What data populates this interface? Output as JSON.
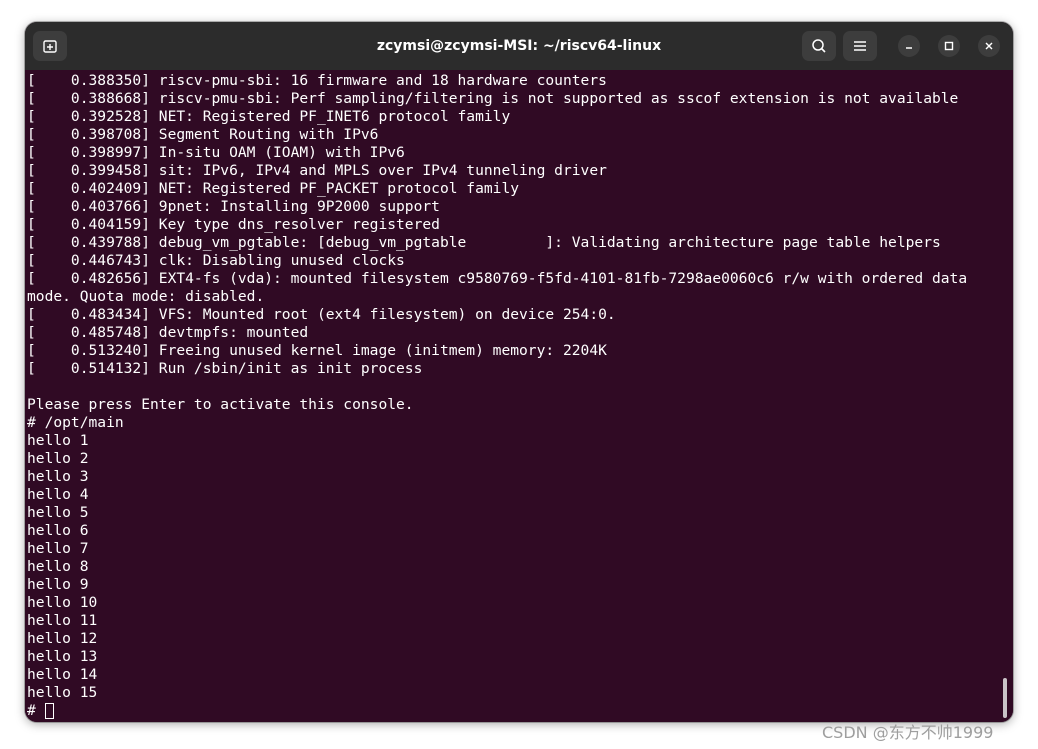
{
  "window": {
    "title": "zcymsi@zcymsi-MSI: ~/riscv64-linux"
  },
  "titlebar": {
    "new_tab_icon": "new-tab-icon",
    "search_icon": "search-icon",
    "menu_icon": "hamburger-menu-icon",
    "minimize_icon": "minimize-icon",
    "maximize_icon": "maximize-icon",
    "close_icon": "close-icon"
  },
  "terminal": {
    "background": "#300a24",
    "foreground": "#ffffff",
    "lines": [
      "[    0.388350] riscv-pmu-sbi: 16 firmware and 18 hardware counters",
      "[    0.388668] riscv-pmu-sbi: Perf sampling/filtering is not supported as sscof extension is not available",
      "[    0.392528] NET: Registered PF_INET6 protocol family",
      "[    0.398708] Segment Routing with IPv6",
      "[    0.398997] In-situ OAM (IOAM) with IPv6",
      "[    0.399458] sit: IPv6, IPv4 and MPLS over IPv4 tunneling driver",
      "[    0.402409] NET: Registered PF_PACKET protocol family",
      "[    0.403766] 9pnet: Installing 9P2000 support",
      "[    0.404159] Key type dns_resolver registered",
      "[    0.439788] debug_vm_pgtable: [debug_vm_pgtable         ]: Validating architecture page table helpers",
      "[    0.446743] clk: Disabling unused clocks",
      "[    0.482656] EXT4-fs (vda): mounted filesystem c9580769-f5fd-4101-81fb-7298ae0060c6 r/w with ordered data",
      "mode. Quota mode: disabled.",
      "[    0.483434] VFS: Mounted root (ext4 filesystem) on device 254:0.",
      "[    0.485748] devtmpfs: mounted",
      "[    0.513240] Freeing unused kernel image (initmem) memory: 2204K",
      "[    0.514132] Run /sbin/init as init process",
      "",
      "Please press Enter to activate this console.",
      "# /opt/main",
      "hello 1",
      "hello 2",
      "hello 3",
      "hello 4",
      "hello 5",
      "hello 6",
      "hello 7",
      "hello 8",
      "hello 9",
      "hello 10",
      "hello 11",
      "hello 12",
      "hello 13",
      "hello 14",
      "hello 15"
    ],
    "prompt": "# "
  },
  "watermark": "CSDN @东方不帅1999"
}
